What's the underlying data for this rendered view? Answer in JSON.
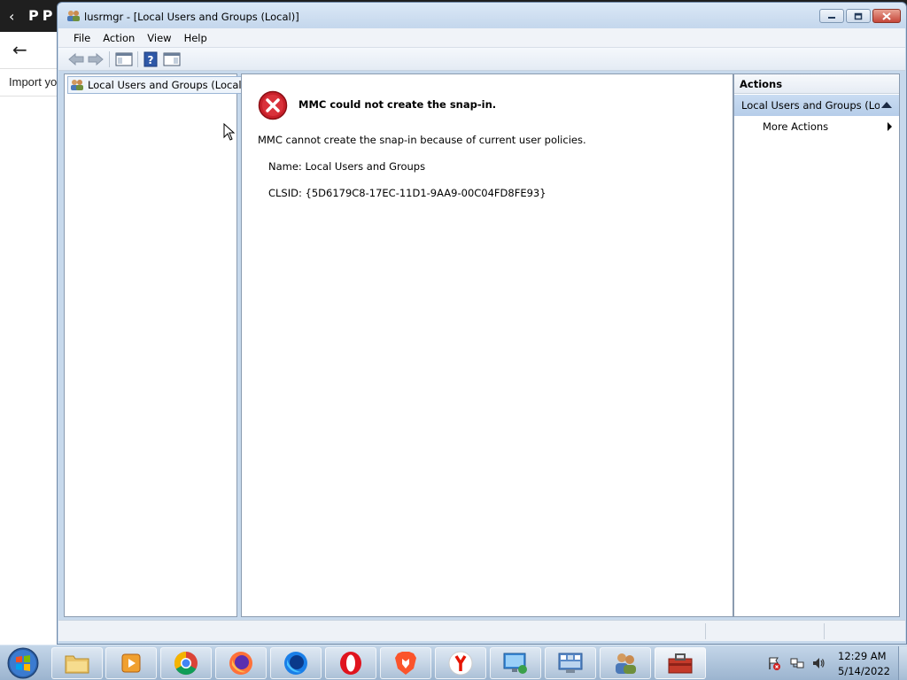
{
  "background_app": {
    "import_text": "Import yo"
  },
  "window": {
    "title": "lusrmgr - [Local Users and Groups (Local)]"
  },
  "menu": [
    "File",
    "Action",
    "View",
    "Help"
  ],
  "tree": {
    "root_label": "Local Users and Groups (Local)"
  },
  "error": {
    "title": "MMC could not create the snap-in.",
    "message": "MMC cannot create the snap-in because of current user policies.",
    "name_line": "Name: Local Users and Groups",
    "clsid_line": "CLSID: {5D6179C8-17EC-11D1-9AA9-00C04FD8FE93}"
  },
  "actions": {
    "header": "Actions",
    "group_label": "Local Users and Groups (Lo...",
    "more_actions": "More Actions"
  },
  "taskbar": {
    "apps": [
      "file-explorer",
      "media-player",
      "chrome",
      "firefox",
      "firefox-developer",
      "opera",
      "brave",
      "yandex",
      "remote-desktop",
      "control-panel",
      "users-manager",
      "toolbox"
    ],
    "time": "12:29 AM",
    "date": "5/14/2022"
  },
  "colors": {
    "error_red": "#c8202a",
    "selection_blue": "#b6cde9",
    "taskbar_blue": "#a9bfd8"
  }
}
